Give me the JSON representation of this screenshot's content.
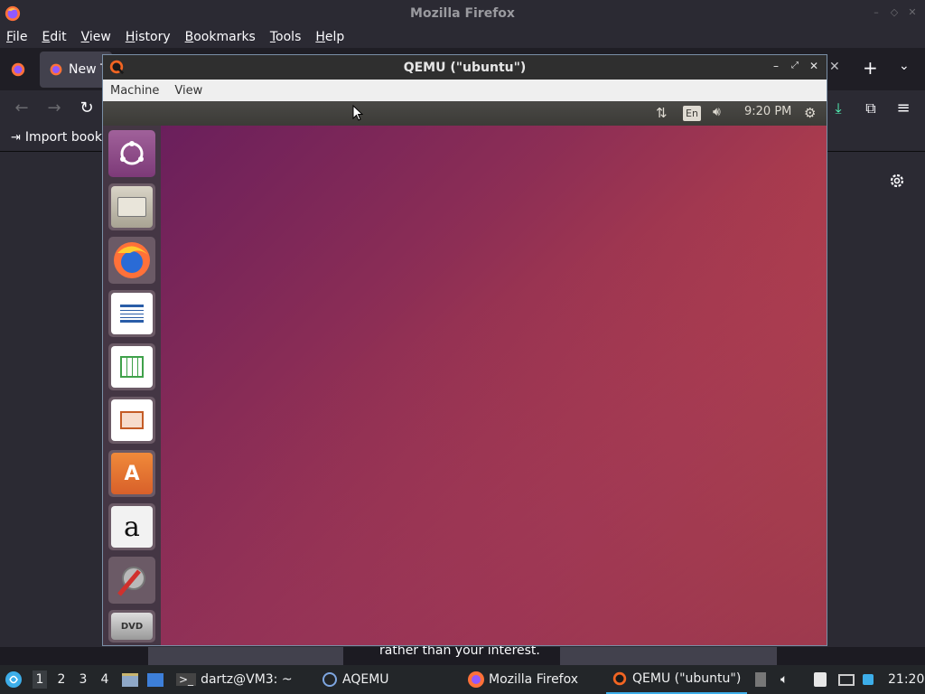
{
  "firefox": {
    "window_title": "Mozilla Firefox",
    "menu": [
      {
        "label": "File",
        "key": "F",
        "rest": "ile"
      },
      {
        "label": "Edit",
        "key": "E",
        "rest": "dit"
      },
      {
        "label": "View",
        "key": "V",
        "rest": "iew"
      },
      {
        "label": "History",
        "key": "H",
        "rest": "istory"
      },
      {
        "label": "Bookmarks",
        "key": "B",
        "rest": "ookmarks"
      },
      {
        "label": "Tools",
        "key": "T",
        "rest": "ools"
      },
      {
        "label": "Help",
        "key": "H",
        "rest": "elp"
      }
    ],
    "tab_label": "New T",
    "bookmark_import": "Import book",
    "snippet": "rather than your interest."
  },
  "qemu": {
    "title": "QEMU (\"ubuntu\")",
    "menu": [
      "Machine",
      "View"
    ]
  },
  "ubuntu": {
    "keyboard": "En",
    "clock": "9:20 PM",
    "launcher": [
      "ubuntu-dash",
      "files",
      "firefox",
      "libreoffice-writer",
      "libreoffice-calc",
      "libreoffice-impress",
      "ubuntu-software",
      "amazon",
      "system-settings",
      "dvd-drive"
    ]
  },
  "taskbar": {
    "workspaces": [
      "1",
      "2",
      "3",
      "4"
    ],
    "terminal": "dartz@VM3: ~",
    "aqemu": "AQEMU",
    "firefox": "Mozilla Firefox",
    "qemu": "QEMU (\"ubuntu\")",
    "clock": "21:20"
  },
  "colors": {
    "accent": "#3daee9",
    "ubuntu_orange": "#e95420"
  }
}
